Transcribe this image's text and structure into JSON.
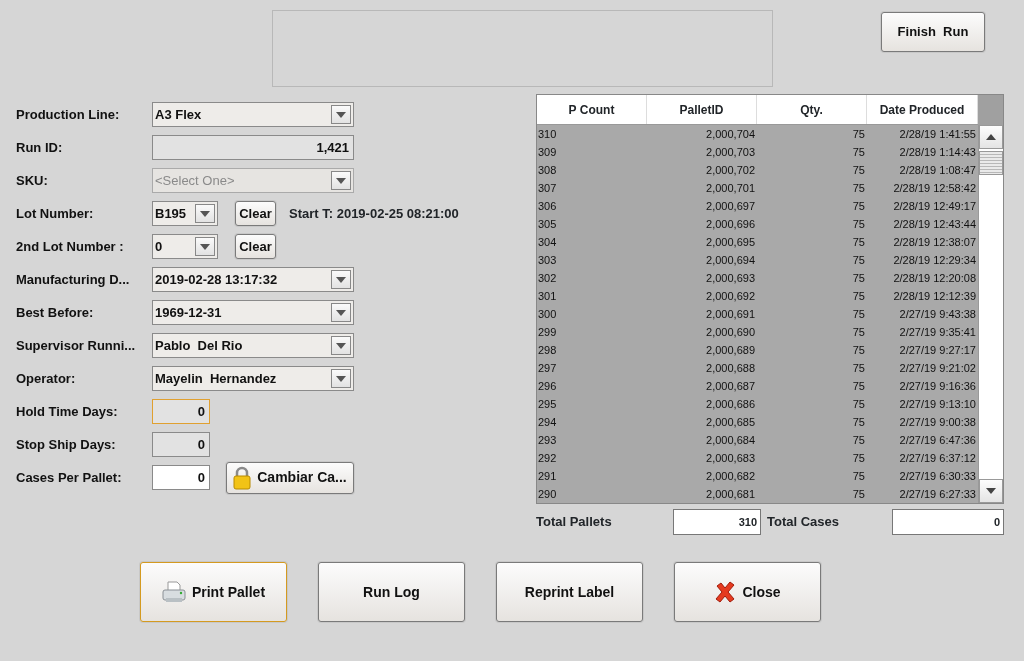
{
  "finish_button": "Finish  Run",
  "form": [
    {
      "label": "Production Line:",
      "kind": "combo",
      "value": "A3 Flex",
      "disabled": false
    },
    {
      "label": "Run ID:",
      "kind": "text",
      "value": "1,421",
      "editable": false
    },
    {
      "label": "SKU:",
      "kind": "combo",
      "value": "<Select One>",
      "disabled": true
    },
    {
      "label": "Lot Number:",
      "kind": "short_combo",
      "value": "B195",
      "button": "Clear",
      "note": "Start T: 2019-02-25 08:21:00"
    },
    {
      "label": "2nd Lot Number :",
      "kind": "short_combo",
      "value": "0",
      "button": "Clear"
    },
    {
      "label": "Manufacturing D...",
      "kind": "combo",
      "value": "2019-02-28 13:17:32",
      "disabled": false
    },
    {
      "label": "Best Before:",
      "kind": "combo",
      "value": "1969-12-31",
      "disabled": false
    },
    {
      "label": "Supervisor Runni...",
      "kind": "combo",
      "value": "Pablo  Del Rio",
      "disabled": false
    },
    {
      "label": "Operator:",
      "kind": "combo",
      "value": "Mayelin  Hernandez",
      "disabled": false
    },
    {
      "label": "Hold Time Days:",
      "kind": "number",
      "value": "0",
      "editable": false,
      "focused": true
    },
    {
      "label": "Stop Ship Days:",
      "kind": "number",
      "value": "0",
      "editable": false,
      "focused": false
    },
    {
      "label": "Cases Per Pallet:",
      "kind": "number",
      "value": "0",
      "editable": true,
      "focused": false,
      "button": "Cambiar Ca..."
    }
  ],
  "table": {
    "columns": [
      "P Count",
      "PalletID",
      "Qty.",
      "Date Produced"
    ],
    "rows": [
      [
        "310",
        "2,000,704",
        "75",
        "2/28/19 1:41:55"
      ],
      [
        "309",
        "2,000,703",
        "75",
        "2/28/19 1:14:43"
      ],
      [
        "308",
        "2,000,702",
        "75",
        "2/28/19 1:08:47"
      ],
      [
        "307",
        "2,000,701",
        "75",
        "2/28/19 12:58:42"
      ],
      [
        "306",
        "2,000,697",
        "75",
        "2/28/19 12:49:17"
      ],
      [
        "305",
        "2,000,696",
        "75",
        "2/28/19 12:43:44"
      ],
      [
        "304",
        "2,000,695",
        "75",
        "2/28/19 12:38:07"
      ],
      [
        "303",
        "2,000,694",
        "75",
        "2/28/19 12:29:34"
      ],
      [
        "302",
        "2,000,693",
        "75",
        "2/28/19 12:20:08"
      ],
      [
        "301",
        "2,000,692",
        "75",
        "2/28/19 12:12:39"
      ],
      [
        "300",
        "2,000,691",
        "75",
        "2/27/19 9:43:38"
      ],
      [
        "299",
        "2,000,690",
        "75",
        "2/27/19 9:35:41"
      ],
      [
        "298",
        "2,000,689",
        "75",
        "2/27/19 9:27:17"
      ],
      [
        "297",
        "2,000,688",
        "75",
        "2/27/19 9:21:02"
      ],
      [
        "296",
        "2,000,687",
        "75",
        "2/27/19 9:16:36"
      ],
      [
        "295",
        "2,000,686",
        "75",
        "2/27/19 9:13:10"
      ],
      [
        "294",
        "2,000,685",
        "75",
        "2/27/19 9:00:38"
      ],
      [
        "293",
        "2,000,684",
        "75",
        "2/27/19 6:47:36"
      ],
      [
        "292",
        "2,000,683",
        "75",
        "2/27/19 6:37:12"
      ],
      [
        "291",
        "2,000,682",
        "75",
        "2/27/19 6:30:33"
      ],
      [
        "290",
        "2,000,681",
        "75",
        "2/27/19 6:27:33"
      ]
    ]
  },
  "totals": [
    {
      "label": "Total Pallets",
      "value": "310"
    },
    {
      "label": "Total Cases",
      "value": "0"
    }
  ],
  "buttons": [
    {
      "label": "Print Pallet",
      "kind": "print",
      "focused": true
    },
    {
      "label": "Run Log",
      "kind": "plain",
      "focused": false
    },
    {
      "label": "Reprint Label",
      "kind": "plain",
      "focused": false
    },
    {
      "label": "Close",
      "kind": "close",
      "focused": false
    }
  ]
}
